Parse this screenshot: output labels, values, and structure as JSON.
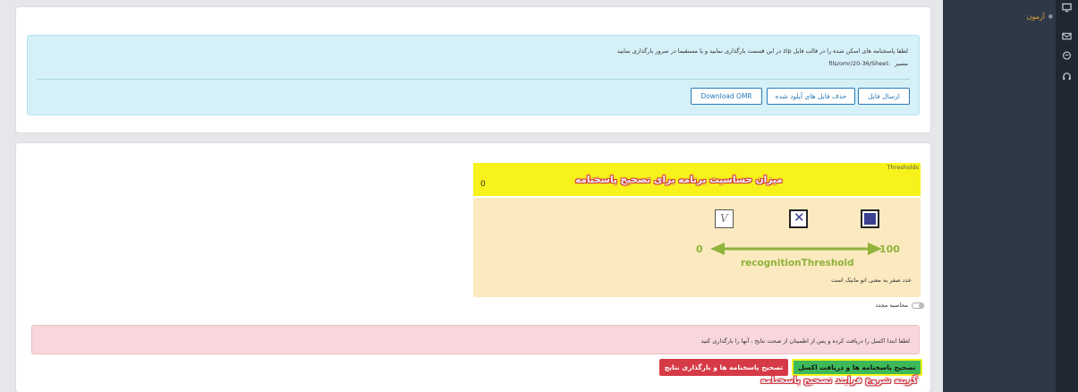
{
  "sidebar": {
    "menu_item": "آزمون",
    "rail_icons": [
      "monitor-icon",
      "mail-icon",
      "chat-icon",
      "headset-icon"
    ]
  },
  "upload": {
    "instruction": "لطفا پاسخنامه های اسکن شده را در قالب فایل zip در این قسمت بارگذاری نمایید و یا مستقیما در سرور بارگذاری نمایید",
    "path_label": "مسیر",
    "path_value": "fils/omr/20-36/Sheet:",
    "send_button": "ارسال فایل",
    "delete_button": "حذف فایل های آپلود شده",
    "download_button": "Download OMR"
  },
  "thresholds": {
    "label": "Thresholds",
    "value": "0",
    "annotation": "میزان حساسیت برنامه برای تصحیح پاسخنامه",
    "scale_min": "0",
    "scale_max": "100",
    "scale_name": "recognitionThreshold",
    "note": "عدد صفر به معنی اتو ماتیک است"
  },
  "recalculate_label": "محاسبه مجدد",
  "alert_text": "لطفا ابتدا اکسل را دریافت کرده و پس از اطمینان از صحت نتایج ، آنها را بارگذاری کنید",
  "actions": {
    "correct_download": "تصحیح پاسخنامه ها و دریافت اکسل",
    "correct_upload": "تصحیح پاسخنامه ها و بارگذاری نتایج",
    "annotation": "گزینه شروع فرایند تصحیح پاسخنامه"
  },
  "colors": {
    "sidebar": "#2e3846",
    "highlight": "#f7f21b",
    "info_bg": "#d6f0f8",
    "alert_bg": "#f8d7dc",
    "green": "#3db95a",
    "red": "#d63a46",
    "scale": "#8fb33b"
  }
}
